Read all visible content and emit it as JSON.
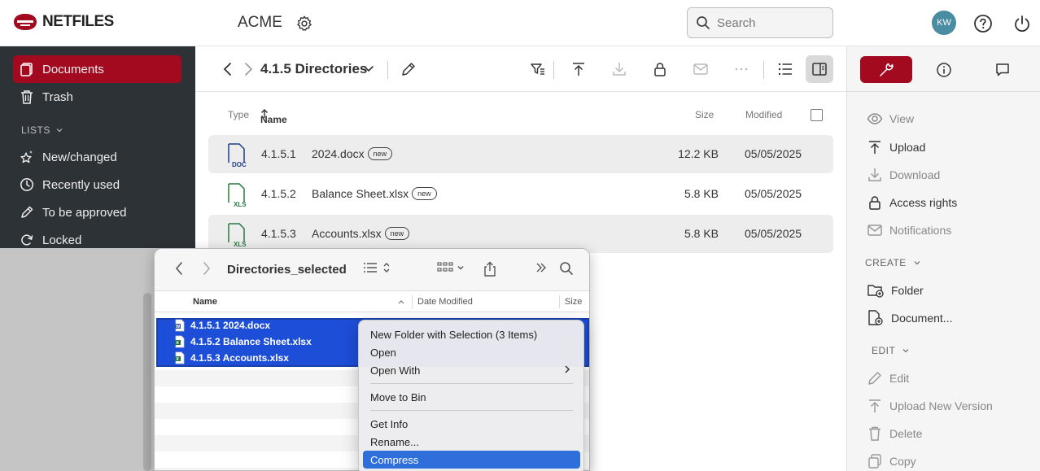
{
  "app": {
    "logo_text": "NETFILES",
    "org_name": "ACME",
    "search_placeholder": "Search",
    "user_initials": "KW",
    "brand_color": "#a3091f"
  },
  "sidebar": {
    "items": [
      {
        "label": "Documents",
        "icon": "documents-icon",
        "active": true
      },
      {
        "label": "Trash",
        "icon": "trash-icon"
      }
    ],
    "lists_label": "LISTS",
    "list_items": [
      {
        "label": "New/changed",
        "icon": "sparkle-star-icon"
      },
      {
        "label": "Recently used",
        "icon": "clock-icon"
      },
      {
        "label": "To be approved",
        "icon": "pencil-icon"
      },
      {
        "label": "Locked",
        "icon": "refresh-lock-icon"
      }
    ]
  },
  "main": {
    "path_title": "4.1.5 Directories",
    "columns": {
      "type": "Type",
      "name": "Name",
      "size": "Size",
      "modified": "Modified"
    },
    "files": [
      {
        "type_icon": "DOC",
        "number": "4.1.5.1",
        "name": "2024.docx",
        "badge": "new",
        "size": "12.2 KB",
        "modified": "05/05/2025"
      },
      {
        "type_icon": "XLS",
        "number": "4.1.5.2",
        "name": "Balance Sheet.xlsx",
        "badge": "new",
        "size": "5.8 KB",
        "modified": "05/05/2025"
      },
      {
        "type_icon": "XLS",
        "number": "4.1.5.3",
        "name": "Accounts.xlsx",
        "badge": "new",
        "size": "5.8 KB",
        "modified": "05/05/2025"
      }
    ]
  },
  "right_panel": {
    "actions": [
      {
        "label": "View",
        "icon": "eye-icon",
        "enabled": false
      },
      {
        "label": "Upload",
        "icon": "upload-icon",
        "enabled": true
      },
      {
        "label": "Download",
        "icon": "download-icon",
        "enabled": false
      },
      {
        "label": "Access rights",
        "icon": "lock-icon",
        "enabled": true
      },
      {
        "label": "Notifications",
        "icon": "mail-icon",
        "enabled": false
      }
    ],
    "create_label": "CREATE",
    "create_items": [
      {
        "label": "Folder",
        "icon": "add-folder-icon"
      },
      {
        "label": "Document...",
        "icon": "add-document-icon"
      }
    ],
    "edit_label": "EDIT",
    "edit_items": [
      {
        "label": "Edit",
        "icon": "pencil-icon"
      },
      {
        "label": "Upload New Version",
        "icon": "upload-icon"
      },
      {
        "label": "Delete",
        "icon": "trash-icon"
      },
      {
        "label": "Copy",
        "icon": "copy-icon"
      }
    ]
  },
  "finder": {
    "title": "Directories_selected",
    "columns": {
      "name": "Name",
      "date_modified": "Date Modified",
      "size": "Size"
    },
    "files": [
      {
        "name": "4.1.5.1 2024.docx",
        "icon": "word-file-icon"
      },
      {
        "name": "4.1.5.2 Balance Sheet.xlsx",
        "icon": "excel-file-icon"
      },
      {
        "name": "4.1.5.3 Accounts.xlsx",
        "icon": "excel-file-icon"
      }
    ],
    "selection_color": "#1d4ed8"
  },
  "context_menu": {
    "items": [
      {
        "label": "New Folder with Selection (3 Items)"
      },
      {
        "label": "Open"
      },
      {
        "label": "Open With",
        "submenu": true
      },
      {
        "label": "Move to Bin"
      },
      {
        "label": "Get Info"
      },
      {
        "label": "Rename..."
      },
      {
        "label": "Compress",
        "highlighted": true
      }
    ]
  }
}
